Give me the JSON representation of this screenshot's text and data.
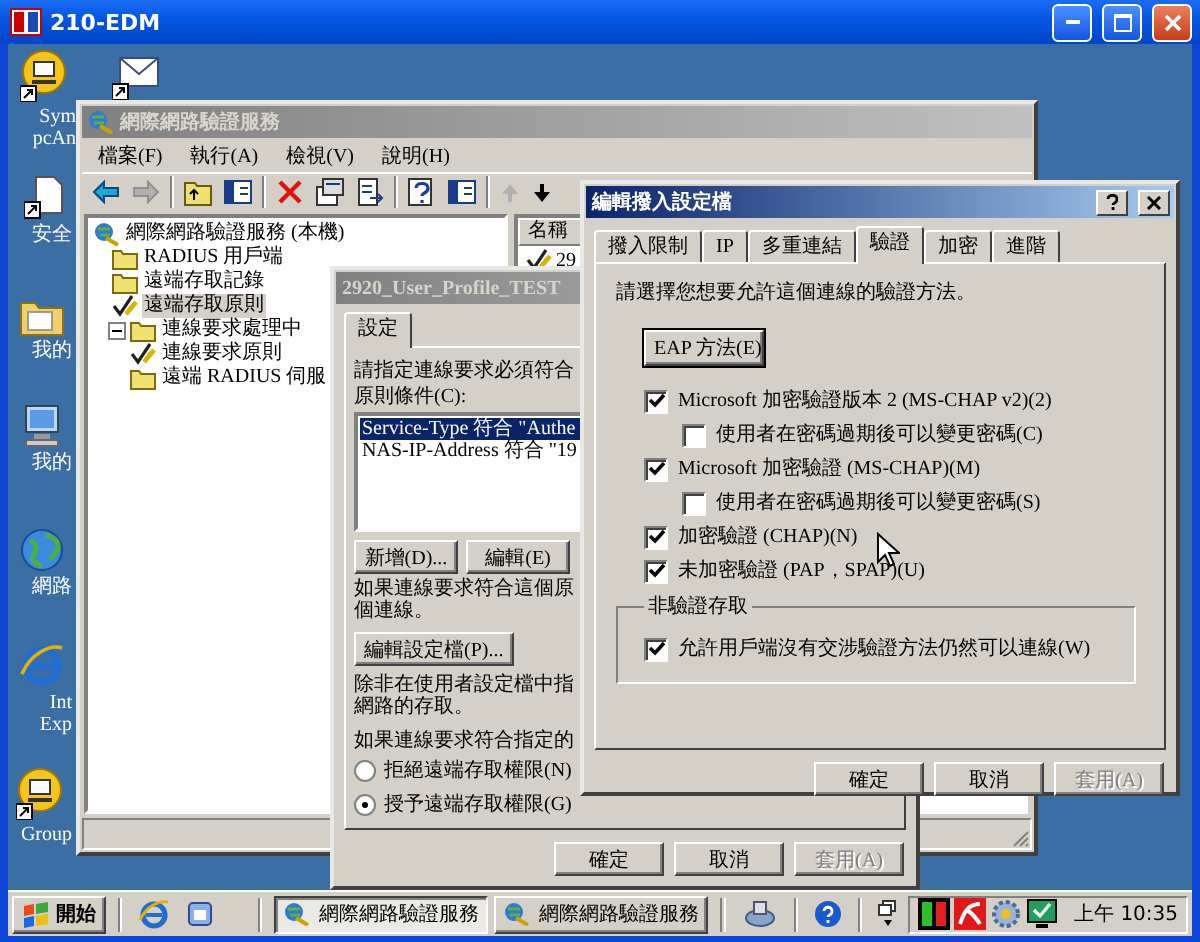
{
  "remote_window": {
    "title": "210-EDM"
  },
  "desktop_icons": [
    {
      "kind": "program",
      "lines": [
        "Sym",
        "pcAn"
      ]
    },
    {
      "kind": "mail"
    },
    {
      "kind": "document",
      "lines": [
        "安全"
      ]
    },
    {
      "kind": "folder",
      "lines": [
        "我的"
      ]
    },
    {
      "kind": "computer",
      "lines": [
        "我的"
      ]
    },
    {
      "kind": "globe",
      "lines": [
        "網路"
      ]
    },
    {
      "kind": "browser",
      "lines": [
        "Int",
        "Exp"
      ]
    },
    {
      "kind": "program",
      "lines": [
        "Group"
      ]
    }
  ],
  "mmc": {
    "title": "網際網路驗證服務",
    "menus": [
      "檔案(F)",
      "執行(A)",
      "檢視(V)",
      "說明(H)"
    ],
    "tree": [
      {
        "label": "網際網路驗證服務 (本機)",
        "kind": "service",
        "selected": false,
        "children": [
          {
            "label": "RADIUS 用戶端",
            "kind": "folder",
            "selected": false
          },
          {
            "label": "遠端存取記錄",
            "kind": "folder",
            "selected": false
          },
          {
            "label": "遠端存取原則",
            "kind": "policy",
            "selected": true
          },
          {
            "label": "連線要求處理中",
            "kind": "folder",
            "selected": false,
            "expanded": true,
            "children": [
              {
                "label": "連線要求原則",
                "kind": "policy",
                "selected": false
              },
              {
                "label": "遠端 RADIUS 伺服",
                "kind": "folder",
                "selected": false
              }
            ]
          }
        ]
      }
    ],
    "list": {
      "column_1": "名稱",
      "rows": [
        "29"
      ]
    }
  },
  "policy_dialog": {
    "title": "2920_User_Profile_TEST",
    "tabs": [
      {
        "label": "設定",
        "selected": true
      }
    ],
    "intro": "請指定連線要求必須符合",
    "conditions_label": "原則條件(C):",
    "conditions": [
      {
        "text": "Service-Type 符合 \"Authe",
        "selected": true
      },
      {
        "text": "NAS-IP-Address 符合 \"19",
        "selected": false
      }
    ],
    "condition_buttons": [
      "新增(D)...",
      "編輯(E)"
    ],
    "match_note": [
      "如果連線要求符合這個原",
      "個連線。"
    ],
    "edit_profile_button": "編輯設定檔(P)...",
    "profile_note": [
      "除非在使用者設定檔中指",
      "網路的存取。"
    ],
    "access_label": "如果連線要求符合指定的",
    "access_options": [
      {
        "label": "拒絕遠端存取權限(N)",
        "selected": false
      },
      {
        "label": "授予遠端存取權限(G)",
        "selected": true
      }
    ],
    "buttons": [
      {
        "label": "確定",
        "disabled": false
      },
      {
        "label": "取消",
        "disabled": false
      },
      {
        "label": "套用(A)",
        "disabled": true
      }
    ]
  },
  "profile_editor": {
    "title": "編輯撥入設定檔",
    "tabs": [
      {
        "label": "撥入限制",
        "selected": false
      },
      {
        "label": "IP",
        "selected": false
      },
      {
        "label": "多重連結",
        "selected": false
      },
      {
        "label": "驗證",
        "selected": true
      },
      {
        "label": "加密",
        "selected": false
      },
      {
        "label": "進階",
        "selected": false
      }
    ],
    "instruction": "請選擇您想要允許這個連線的驗證方法。",
    "eap_button": "EAP 方法(E)",
    "methods": [
      {
        "label": "Microsoft 加密驗證版本 2 (MS-CHAP v2)(2)",
        "checked": true,
        "children": [
          {
            "label": "使用者在密碼過期後可以變更密碼(C)",
            "checked": false
          }
        ]
      },
      {
        "label": "Microsoft 加密驗證 (MS-CHAP)(M)",
        "checked": true,
        "children": [
          {
            "label": "使用者在密碼過期後可以變更密碼(S)",
            "checked": false
          }
        ]
      },
      {
        "label": "加密驗證 (CHAP)(N)",
        "checked": true
      },
      {
        "label": "未加密驗證 (PAP，SPAP)(U)",
        "checked": true
      }
    ],
    "unauthenticated_group": {
      "title": "非驗證存取",
      "options": [
        {
          "label": "允許用戶端沒有交涉驗證方法仍然可以連線(W)",
          "checked": true
        }
      ]
    },
    "buttons": [
      {
        "label": "確定",
        "disabled": false
      },
      {
        "label": "取消",
        "disabled": false
      },
      {
        "label": "套用(A)",
        "disabled": true
      }
    ]
  },
  "taskbar": {
    "start": "開始",
    "tasks": [
      {
        "label": "網際網路驗證服務",
        "selected": true
      },
      {
        "label": "網際網路驗證服務",
        "selected": false
      }
    ],
    "clock": "上午 10:35"
  }
}
